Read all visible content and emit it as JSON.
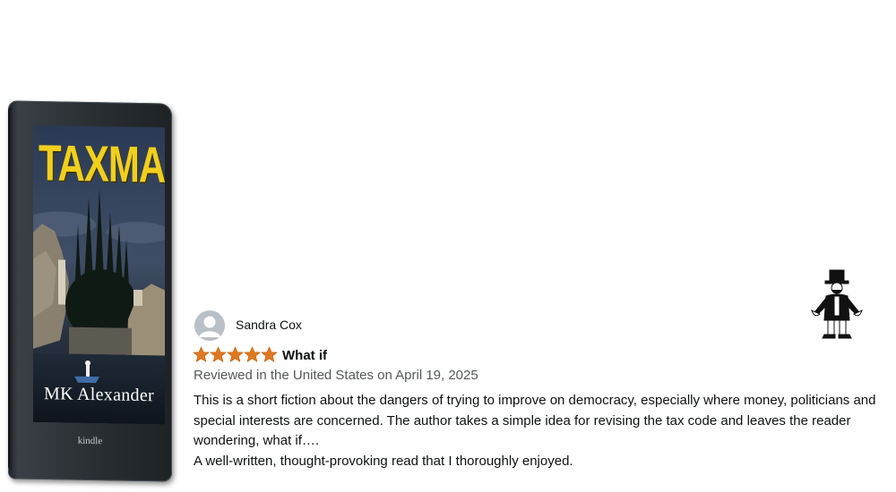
{
  "book": {
    "title": "TAXMAN",
    "author": "MK Alexander",
    "device_brand": "kindle"
  },
  "review": {
    "reviewer_name": "Sandra Cox",
    "rating": 5,
    "max_rating": 5,
    "title": "What if",
    "meta": "Reviewed in the United States on April 19, 2025",
    "body_paragraph_1": "This is a short fiction about the dangers of trying to improve on democracy, especially where money, politicians and special interests are concerned. The author takes a simple idea for revising the tax code and leaves the reader wondering, what if….",
    "body_paragraph_2": "A well-written, thought-provoking read that I thoroughly enjoyed."
  },
  "colors": {
    "star": "#de7921",
    "cover_title": "#f1cf1d",
    "meta_text": "#565959"
  },
  "icons": {
    "avatar": "default-user-avatar-icon",
    "mascot": "monopoly-man-empty-pockets-icon"
  }
}
